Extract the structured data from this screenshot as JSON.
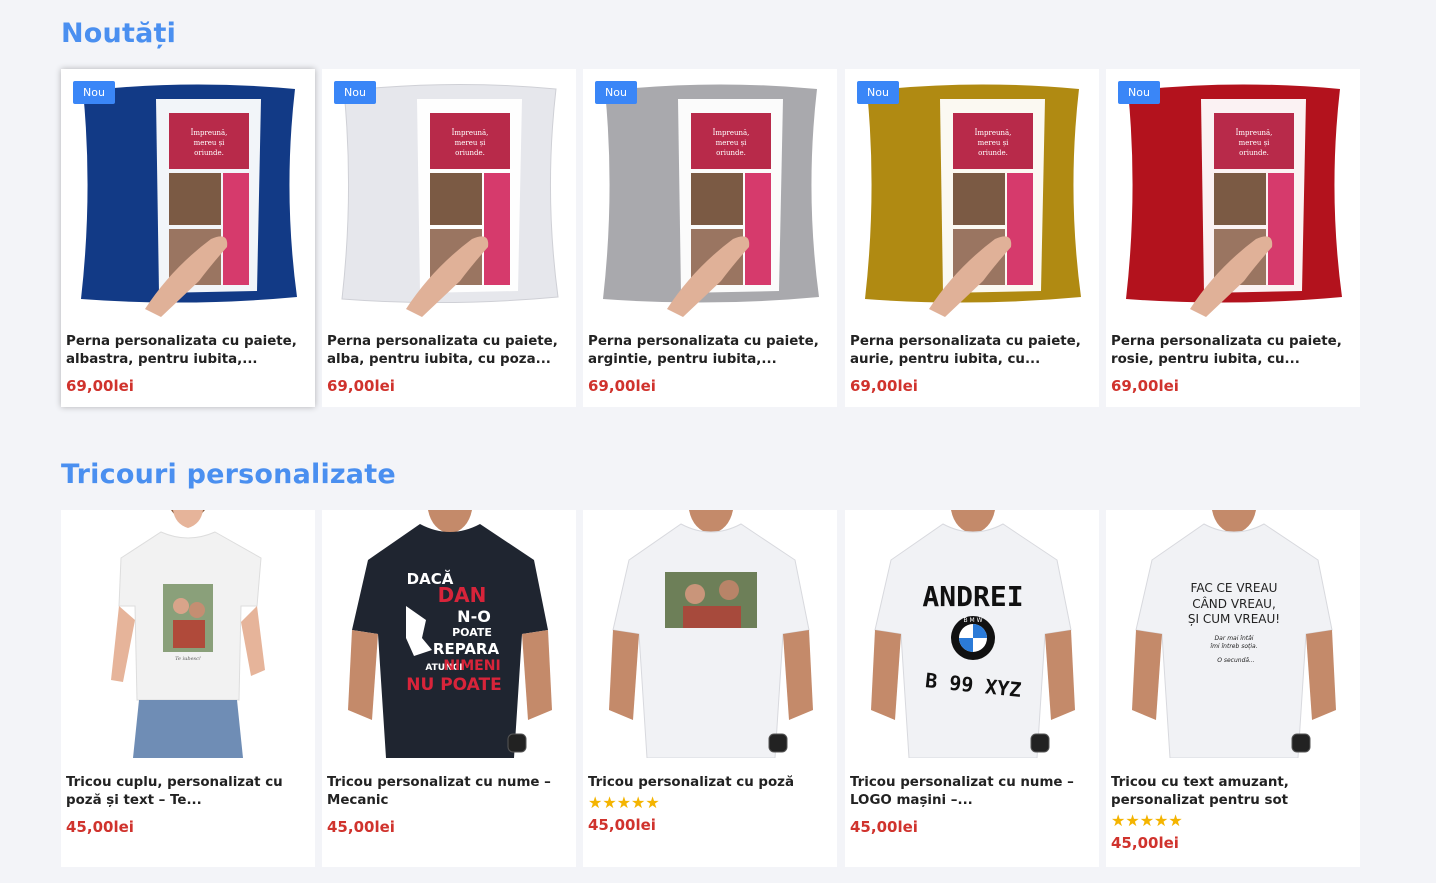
{
  "sections": [
    {
      "title": "Noutăți",
      "products": [
        {
          "badge": "Nou",
          "title": "Perna personalizata cu paiete, albastra, pentru iubita,...",
          "price": "69,00lei",
          "color": "#123a86"
        },
        {
          "badge": "Nou",
          "title": "Perna personalizata cu paiete, alba, pentru iubita, cu poza...",
          "price": "69,00lei",
          "color": "#e9eaee"
        },
        {
          "badge": "Nou",
          "title": "Perna personalizata cu paiete, argintie, pentru iubita,...",
          "price": "69,00lei",
          "color": "#a9a9ad"
        },
        {
          "badge": "Nou",
          "title": "Perna personalizata cu paiete, aurie, pentru iubita, cu...",
          "price": "69,00lei",
          "color": "#b08a12"
        },
        {
          "badge": "Nou",
          "title": "Perna personalizata cu paiete, rosie, pentru iubita, cu...",
          "price": "69,00lei",
          "color": "#b3121d"
        }
      ]
    },
    {
      "title": "Tricouri personalizate",
      "products": [
        {
          "title": "Tricou cuplu, personalizat cu poză și text – Te...",
          "price": "45,00lei",
          "rating": 0
        },
        {
          "title": "Tricou personalizat cu nume – Mecanic",
          "price": "45,00lei",
          "rating": 0
        },
        {
          "title": "Tricou personalizat cu poză",
          "price": "45,00lei",
          "rating": 5
        },
        {
          "title": "Tricou personalizat cu nume – LOGO mașini –...",
          "price": "45,00lei",
          "rating": 0
        },
        {
          "title": "Tricou cu text amuzant, personalizat pentru sot",
          "price": "45,00lei",
          "rating": 5
        }
      ]
    }
  ],
  "pillow_print_text": "Împreună, mereu și oriunde.",
  "shirt_prints": {
    "mecanic": [
      "DACĂ",
      "DAN",
      "N-O",
      "POATE",
      "REPARA",
      "ATUNCI",
      "NIMENI",
      "NU POATE"
    ],
    "logo": [
      "ANDREI",
      "BMW",
      "B 99 XYZ"
    ],
    "funny": [
      "FAC CE VREAU",
      "CÂND VREAU,",
      "ȘI CUM VREAU!",
      "Dar mai întâi",
      "îmi întreb soția.",
      "O secundă..."
    ]
  },
  "star_glyph": "★★★★★"
}
